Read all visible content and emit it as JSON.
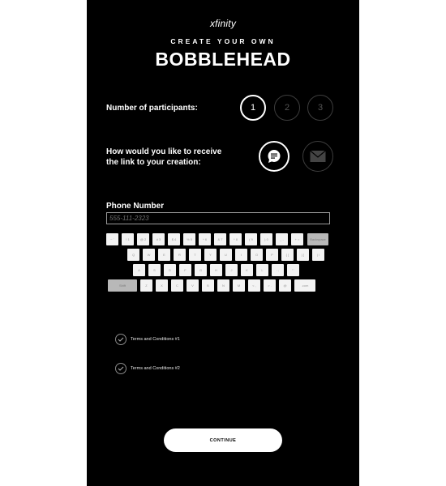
{
  "brand": "xfinity",
  "header": {
    "subtitle": "CREATE YOUR OWN",
    "title": "BOBBLEHEAD"
  },
  "participants": {
    "label": "Number of participants:",
    "options": [
      "1",
      "2",
      "3"
    ],
    "selected": "1"
  },
  "delivery": {
    "label_line1": "How would you like to receive",
    "label_line2": "the link to your creation:",
    "options": [
      "text-message",
      "email"
    ],
    "selected": "text-message"
  },
  "phone": {
    "label": "Phone Number",
    "placeholder": "555-111-2323",
    "value": ""
  },
  "keyboard": {
    "row1": [
      "~ `",
      "! 1",
      "@ 2",
      "# 3",
      "$ 4",
      "% 5",
      "^ 6",
      "& 7",
      "* 8",
      "( 9",
      ") 0",
      "_ -",
      "+ =",
      "Backspace"
    ],
    "row2": [
      "Q",
      "W",
      "E",
      "R",
      "T",
      "Y",
      "U",
      "I",
      "O",
      "P",
      "{ [",
      "} ]",
      "| \\"
    ],
    "row3": [
      "A",
      "S",
      "D",
      "F",
      "G",
      "H",
      "J",
      "K",
      "L",
      ": ;",
      "\" '"
    ],
    "row4": [
      "Shift",
      "Z",
      "X",
      "C",
      "V",
      "B",
      "N",
      "M",
      "< ,",
      "> .",
      "@",
      ".com"
    ]
  },
  "terms": [
    "Terms and Conditions #1",
    "Terms and Conditions #2"
  ],
  "continue_label": "CONTINUE",
  "colors": {
    "background": "#000000",
    "text": "#ffffff",
    "inactive": "#3d3d3d"
  }
}
